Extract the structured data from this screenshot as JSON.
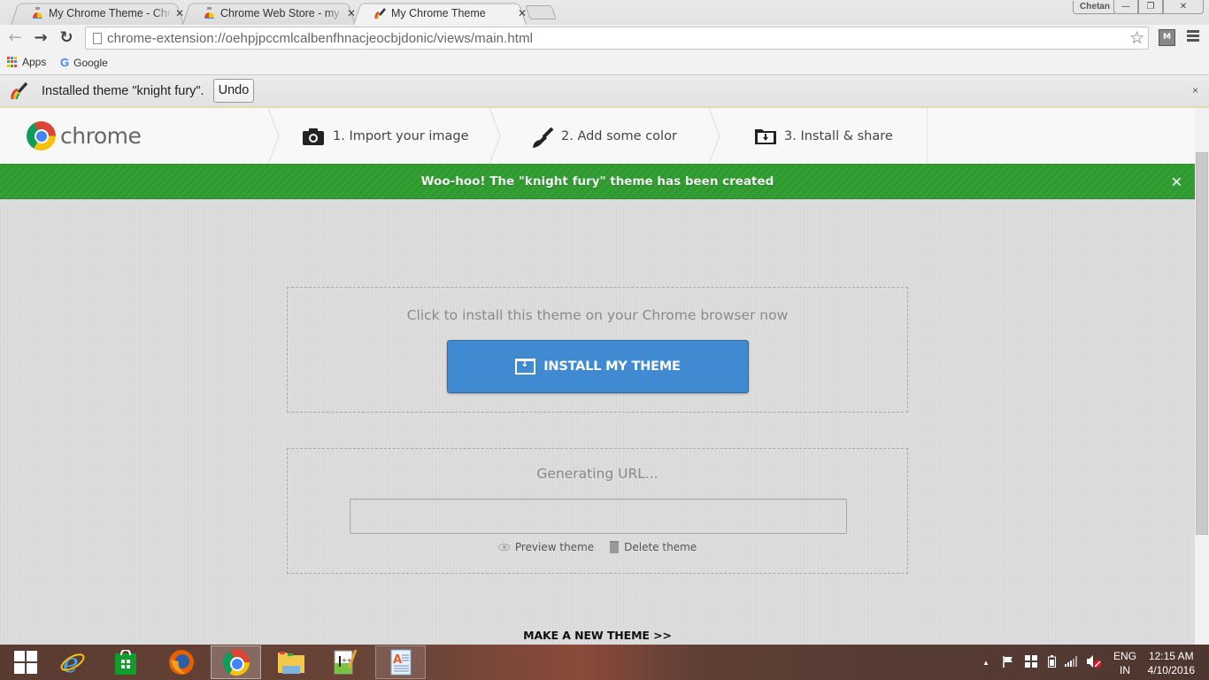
{
  "browser": {
    "tabs": [
      {
        "title": "My Chrome Theme - Chrome Web Store",
        "active": false,
        "favicon": "webstore-icon"
      },
      {
        "title": "Chrome Web Store - my chrome theme",
        "active": false,
        "favicon": "webstore-icon"
      },
      {
        "title": "My Chrome Theme",
        "active": true,
        "favicon": "theme-brush-icon"
      }
    ],
    "tab_close_glyph": "✕",
    "profile_name": "Chetan",
    "window_controls": {
      "minimize": "—",
      "restore": "❐",
      "close": "✕"
    },
    "nav": {
      "back": "←",
      "forward": "→",
      "reload": "↻"
    },
    "url": "chrome-extension://oehpjpccmlcalbenfhnacjeocbjdonic/views/main.html",
    "star_glyph": "☆",
    "extension_badge": "M",
    "bookmarks": [
      {
        "label": "Apps",
        "icon": "apps-grid-icon"
      },
      {
        "label": "Google",
        "icon": "google-icon"
      }
    ],
    "apps_colors": [
      "#e94235",
      "#4285f4",
      "#fbbc05",
      "#34a853",
      "#e94235",
      "#4285f4",
      "#fbbc05",
      "#34a853",
      "#e94235"
    ]
  },
  "infobar": {
    "message": "Installed theme \"knight fury\".",
    "undo_label": "Undo",
    "close_glyph": "×"
  },
  "app": {
    "logo_text": "chrome",
    "steps": [
      {
        "label": "1. Import your image",
        "icon": "camera-icon"
      },
      {
        "label": "2. Add some color",
        "icon": "paintbrush-icon"
      },
      {
        "label": "3. Install & share",
        "icon": "download-box-icon"
      }
    ],
    "success_message": "Woo-hoo! The \"knight fury\" theme has been created",
    "success_close": "✕",
    "install_panel": {
      "lead": "Click to install this theme on your Chrome browser now",
      "button_label": "INSTALL MY THEME"
    },
    "share_panel": {
      "lead": "Generating URL...",
      "url_value": "",
      "preview_label": "Preview theme",
      "delete_label": "Delete theme"
    },
    "make_new_label": "MAKE A NEW THEME >>",
    "colors": {
      "success_green": "#34a034",
      "install_blue": "#3f8ad1"
    }
  },
  "taskbar": {
    "items": [
      {
        "name": "start",
        "icon": "windows-start-icon"
      },
      {
        "name": "internet-explorer",
        "icon": "ie-icon"
      },
      {
        "name": "store",
        "icon": "store-icon"
      },
      {
        "name": "firefox",
        "icon": "firefox-icon"
      },
      {
        "name": "chrome",
        "icon": "chrome-icon",
        "state": "active"
      },
      {
        "name": "file-explorer",
        "icon": "folder-icon"
      },
      {
        "name": "notepad-plus-plus",
        "icon": "notepad-icon"
      },
      {
        "name": "wordpad",
        "icon": "wordpad-icon",
        "state": "open"
      }
    ],
    "tray": {
      "show_hidden": "▲",
      "language_top": "ENG",
      "language_bottom": "IN",
      "time": "12:15 AM",
      "date": "4/10/2016"
    }
  }
}
